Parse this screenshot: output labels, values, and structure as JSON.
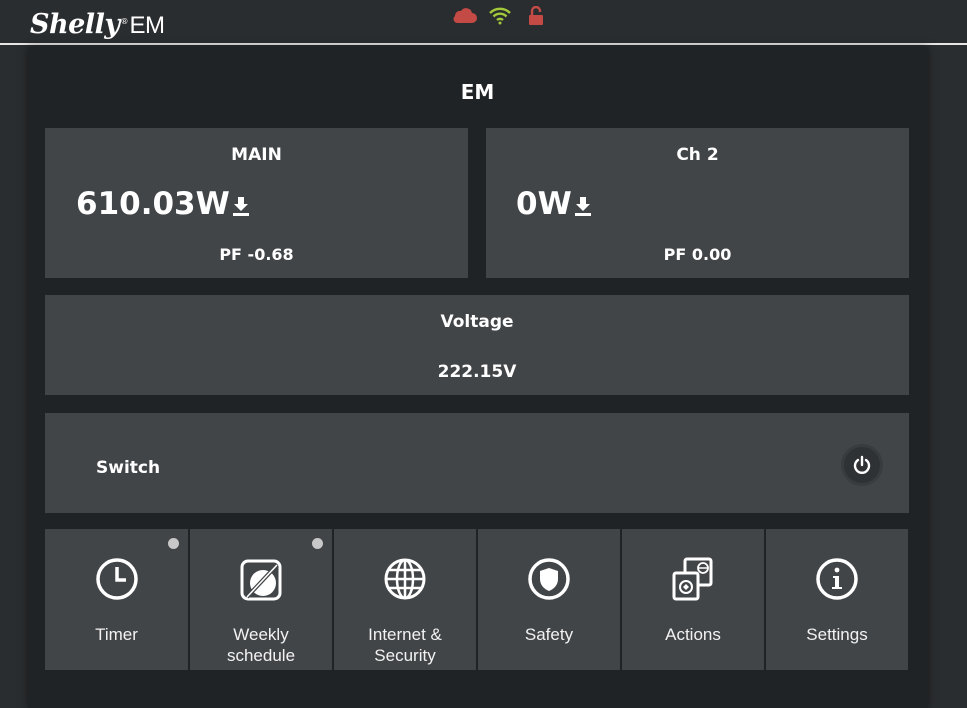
{
  "header": {
    "logo_text": "Shelly",
    "logo_reg": "®",
    "logo_model": "EM",
    "icons": [
      "cloud-icon",
      "wifi-icon",
      "unlocked-icon"
    ],
    "colors": {
      "cloud": "#c44a46",
      "wifi": "#a3c93a",
      "lock": "#c44a46"
    }
  },
  "device": {
    "name": "EM"
  },
  "channels": [
    {
      "title": "MAIN",
      "power": "610.03W",
      "pf": "PF -0.68"
    },
    {
      "title": "Ch 2",
      "power": "0W",
      "pf": "PF 0.00"
    }
  ],
  "voltage": {
    "title": "Voltage",
    "value": "222.15V"
  },
  "switch": {
    "label": "Switch",
    "icon": "power-icon"
  },
  "tiles": [
    {
      "label": "Timer",
      "icon": "clock-icon"
    },
    {
      "label": "Weekly schedule",
      "line1": "Weekly",
      "line2": "schedule",
      "icon": "schedule-icon"
    },
    {
      "label": "Internet & Security",
      "line1": "Internet &",
      "line2": "Security",
      "icon": "globe-icon"
    },
    {
      "label": "Safety",
      "icon": "shield-icon"
    },
    {
      "label": "Actions",
      "icon": "actions-icon"
    },
    {
      "label": "Settings",
      "icon": "info-icon"
    }
  ]
}
